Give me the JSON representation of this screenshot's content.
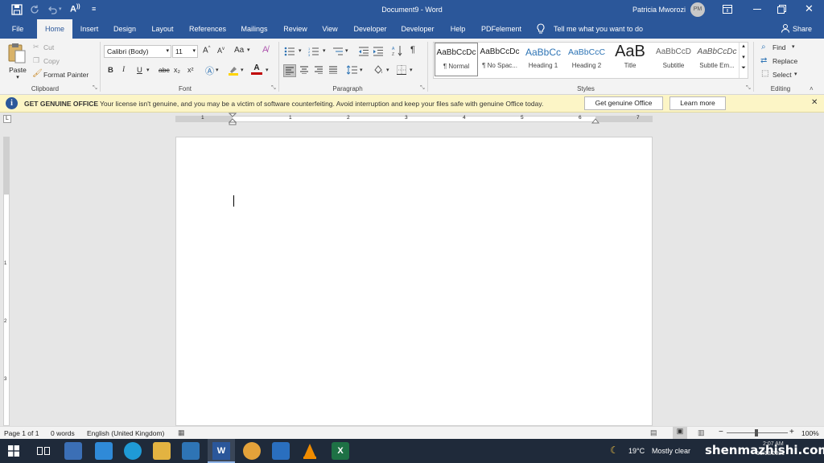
{
  "window": {
    "title": "Document9",
    "app": "Word",
    "separator": "-",
    "user": "Patricia Mworozi",
    "initials": "PM"
  },
  "tabs": [
    "File",
    "Home",
    "Insert",
    "Design",
    "Layout",
    "References",
    "Mailings",
    "Review",
    "View",
    "Developer",
    "Developer",
    "Help",
    "PDFelement"
  ],
  "tell_me": "Tell me what you want to do",
  "share": "Share",
  "clipboard": {
    "paste": "Paste",
    "cut": "Cut",
    "copy": "Copy",
    "format_painter": "Format Painter",
    "label": "Clipboard"
  },
  "font": {
    "family": "Calibri (Body)",
    "size": "11",
    "label": "Font",
    "case": "Aa",
    "bold": "B",
    "italic": "I",
    "underline": "U",
    "strike": "abc",
    "sub": "x₂",
    "sup": "x²"
  },
  "paragraph": {
    "label": "Paragraph"
  },
  "styles": {
    "label": "Styles",
    "items": [
      {
        "preview": "AaBbCcDc",
        "name": "¶ Normal"
      },
      {
        "preview": "AaBbCcDc",
        "name": "¶ No Spac..."
      },
      {
        "preview": "AaBbCc",
        "name": "Heading 1"
      },
      {
        "preview": "AaBbCcC",
        "name": "Heading 2"
      },
      {
        "preview": "AaB",
        "name": "Title"
      },
      {
        "preview": "AaBbCcD",
        "name": "Subtitle"
      },
      {
        "preview": "AaBbCcDc",
        "name": "Subtle Em..."
      }
    ]
  },
  "editing": {
    "find": "Find",
    "replace": "Replace",
    "select": "Select",
    "label": "Editing"
  },
  "message": {
    "title": "GET GENUINE OFFICE",
    "text": "Your license isn't genuine, and you may be a victim of software counterfeiting. Avoid interruption and keep your files safe with genuine Office today.",
    "button1": "Get genuine Office",
    "button2": "Learn more"
  },
  "ruler": {
    "numbers": [
      "1",
      "1",
      "2",
      "3",
      "4",
      "5",
      "6",
      "7"
    ],
    "vnumbers": [
      "1",
      "2",
      "3"
    ]
  },
  "status": {
    "page": "Page 1 of 1",
    "words": "0 words",
    "language": "English (United Kingdom)",
    "zoom": "100%"
  },
  "taskbar": {
    "temperature": "19°C",
    "weather": "Mostly clear",
    "time": "2:07 AM",
    "date": "10/18/2021",
    "watermark": "shenmazhishi.com"
  },
  "colors": {
    "word_blue": "#2b579a",
    "accent_blue": "#2e74b5",
    "highlight_yellow": "#ffd400",
    "font_red": "#c00000"
  }
}
